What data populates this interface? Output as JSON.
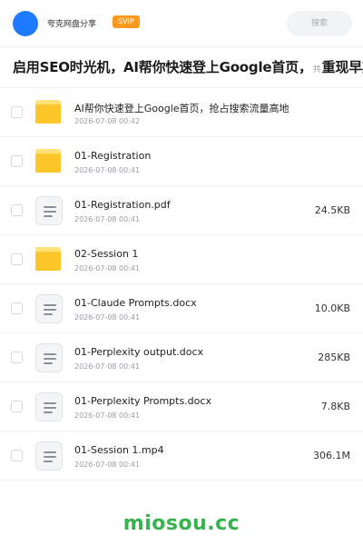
{
  "header": {
    "app_name": "夸克网盘分享",
    "badge": "SVIP",
    "search_placeholder": "搜索"
  },
  "share": {
    "title_main": "启用SEO时光机，AI帮你快速登上Google首页，",
    "title_count": "共",
    "title_tail": "重现早期S"
  },
  "files": [
    {
      "name": "AI帮你快速登上Google首页，抢占搜索流量高地",
      "date": "2026-07-08 00:42",
      "size": "",
      "type": "folder"
    },
    {
      "name": "01-Registration",
      "date": "2026-07-08 00:41",
      "size": "",
      "type": "folder"
    },
    {
      "name": "01-Registration.pdf",
      "date": "2026-07-08 00:41",
      "size": "24.5KB",
      "type": "doc"
    },
    {
      "name": "02-Session 1",
      "date": "2026-07-08 00:41",
      "size": "",
      "type": "folder"
    },
    {
      "name": "01-Claude Prompts.docx",
      "date": "2026-07-08 00:41",
      "size": "10.0KB",
      "type": "doc"
    },
    {
      "name": "01-Perplexity output.docx",
      "date": "2026-07-08 00:41",
      "size": "285KB",
      "type": "doc"
    },
    {
      "name": "01-Perplexity Prompts.docx",
      "date": "2026-07-08 00:41",
      "size": "7.8KB",
      "type": "doc"
    },
    {
      "name": "01-Session 1.mp4",
      "date": "2026-07-08 00:41",
      "size": "306.1M",
      "type": "doc"
    }
  ],
  "watermark": "miosou.cc",
  "colors": {
    "avatar": "#1e7bff",
    "badge": "#ff9a1f",
    "folder": "#ffc62a",
    "watermark": "#37b24d"
  }
}
